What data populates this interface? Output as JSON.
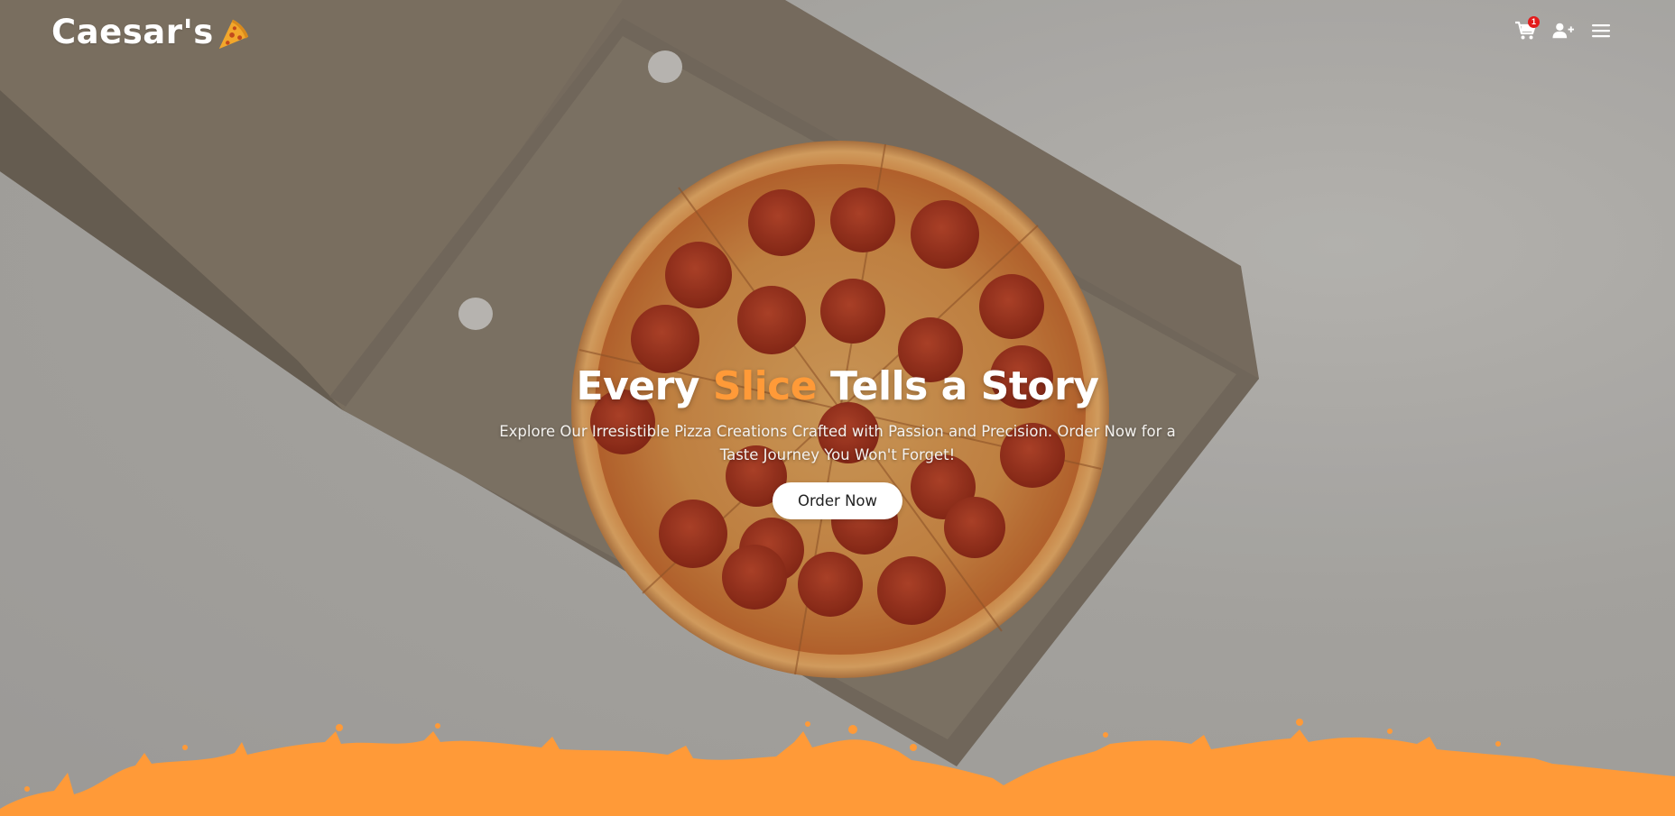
{
  "brand": {
    "name": "Caesar's",
    "accent_color": "#ff9a38",
    "logo_icon": "pizza-slice-icon"
  },
  "nav": {
    "cart": {
      "icon": "cart-icon",
      "badge_count": "1"
    },
    "account": {
      "icon": "add-user-icon"
    },
    "menu": {
      "icon": "hamburger-menu-icon"
    }
  },
  "hero": {
    "title_prefix": "Every",
    "title_accent": "Slice",
    "title_suffix": "Tells a Story",
    "subtitle": "Explore Our Irresistible Pizza Creations Crafted with Passion and Precision. Order Now for a Taste Journey You Won't Forget!",
    "cta_label": "Order Now"
  },
  "colors": {
    "splash": "#ff9a38",
    "badge": "#e31b1b",
    "text": "#ffffff"
  }
}
